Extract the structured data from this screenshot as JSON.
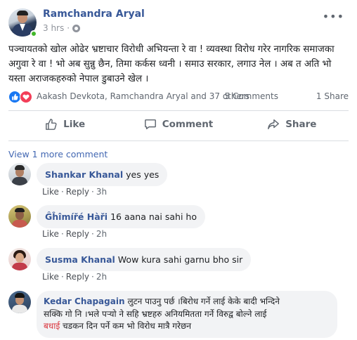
{
  "post": {
    "author": "Ramchandra Aryal",
    "time": "3 hrs",
    "separator": "·",
    "text": "पञ्चायतको खोल ओढेर भ्रष्टाचार विरोधी अभियन्ता रे वा ! व्यवस्था विरोध गरेर नागरिक समाजका अगुवा रे वा ! भो अब सुन्नु छैन, तिमा कर्कस ध्वनी । समाउ सरकार, लगाउ नेल । अब त अति भो यस्ता अराजकहरुको नेपाल डुबाउने खेल ।",
    "more_icon": "•••"
  },
  "reactions": {
    "names": "Aakash Devkota, Ramchandra Aryal and 37 others",
    "comments": "5 Comments",
    "shares": "1 Share",
    "like_icon": "thumbs-up",
    "love_icon": "heart"
  },
  "actions": {
    "like": "Like",
    "comment": "Comment",
    "share": "Share"
  },
  "view_more": "View 1 more comment",
  "comments": [
    {
      "name": "Shankar Khanal",
      "text": "yes yes",
      "like": "Like",
      "reply": "Reply",
      "time": "3h"
    },
    {
      "name": "Ĝĥîmířé Hàři",
      "text": "16 aana nai sahi ho",
      "like": "Like",
      "reply": "Reply",
      "time": "2h"
    },
    {
      "name": "Susma Khanal",
      "text": "Wow kura sahi garnu bho sir",
      "like": "Like",
      "reply": "Reply",
      "time": "2h"
    },
    {
      "name": "Kedar Chapagain",
      "text_line1": "लुटन पाउनु पर्छ ।बिरोध गर्ने लाई केके बादी भन्दिने",
      "text_line2": "सक्कि गो नि ।भले पर्‍यो ने सहि भ्रष्टहरु अनियमितता गर्ने विरुद्व बोल्ने लाई",
      "text_highlight": "बधाई",
      "text_line3_rest": " चडकन दिन पर्ने कम भो विरोध मात्रै गरेछन"
    }
  ],
  "colors": {
    "name_link": "#385898",
    "muted": "#606770",
    "bubble": "#f2f3f5",
    "like_blue": "#1877f2",
    "love_red": "#f33e58",
    "online": "#42b72a"
  }
}
